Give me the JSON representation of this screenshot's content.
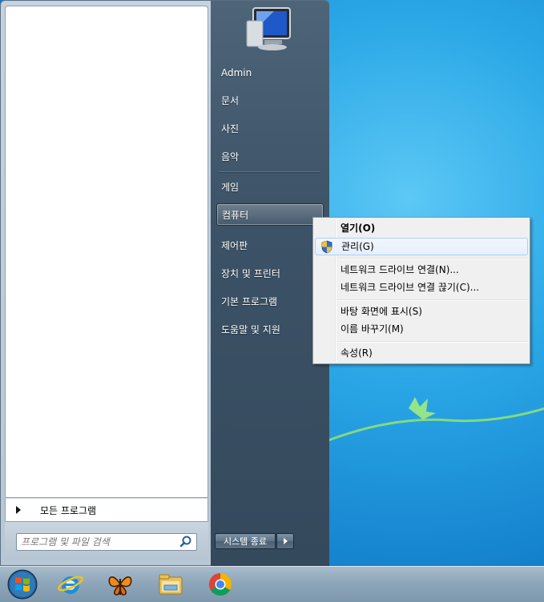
{
  "start_menu": {
    "all_programs_label": "모든 프로그램",
    "search_placeholder": "프로그램 및 파일 검색",
    "right_items": [
      {
        "label": "Admin"
      },
      {
        "label": "문서"
      },
      {
        "label": "사진"
      },
      {
        "label": "음악"
      },
      {
        "label": "게임"
      },
      {
        "label": "컴퓨터"
      },
      {
        "label": "제어판"
      },
      {
        "label": "장치 및 프린터"
      },
      {
        "label": "기본 프로그램"
      },
      {
        "label": "도움말 및 지원"
      }
    ],
    "shutdown_label": "시스템 종료"
  },
  "context_menu": {
    "items": [
      {
        "label": "열기(O)"
      },
      {
        "label": "관리(G)"
      },
      {
        "label": "네트워크 드라이브 연결(N)..."
      },
      {
        "label": "네트워크 드라이브 연결 끊기(C)..."
      },
      {
        "label": "바탕 화면에 표시(S)"
      },
      {
        "label": "이름 바꾸기(M)"
      },
      {
        "label": "속성(R)"
      }
    ]
  },
  "taskbar": {
    "icons": [
      "start-orb-icon",
      "internet-explorer-icon",
      "butterfly-app-icon",
      "file-explorer-icon",
      "chrome-icon"
    ]
  },
  "colors": {
    "right_pane": "#3c5266",
    "highlight_border": "#aecff7",
    "desktop": "#2aa7e6"
  }
}
